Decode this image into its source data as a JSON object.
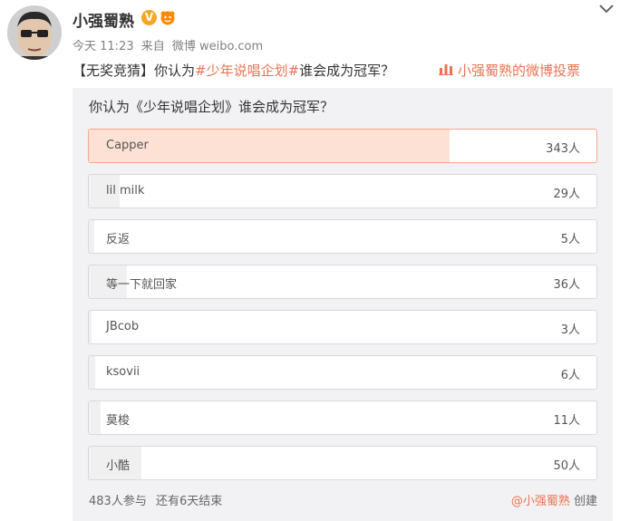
{
  "header": {
    "username": "小强蜀熟",
    "verified_symbol": "V",
    "meta": {
      "time": "今天 11:23",
      "source_prefix": "来自",
      "source": "微博 weibo.com"
    }
  },
  "post": {
    "prefix": "【无奖竞猜】你认为",
    "hashtag": "#少年说唱企划#",
    "suffix": "谁会成为冠军？",
    "vote_link": "小强蜀熟的微博投票"
  },
  "poll": {
    "question": "你认为《少年说唱企划》谁会成为冠军？",
    "options": [
      {
        "label": "Capper",
        "count_text": "343人",
        "votes": 343
      },
      {
        "label": "lil milk",
        "count_text": "29人",
        "votes": 29
      },
      {
        "label": "反返",
        "count_text": "5人",
        "votes": 5
      },
      {
        "label": "等一下就回家",
        "count_text": "36人",
        "votes": 36
      },
      {
        "label": "JBcob",
        "count_text": "3人",
        "votes": 3
      },
      {
        "label": "ksovii",
        "count_text": "6人",
        "votes": 6
      },
      {
        "label": "莫梭",
        "count_text": "11人",
        "votes": 11
      },
      {
        "label": "小酷",
        "count_text": "50人",
        "votes": 50
      }
    ],
    "footer": {
      "participants": "483人参与",
      "remaining": "还有6天结束",
      "creator": "@小强蜀熟",
      "created": "创建"
    }
  },
  "colors": {
    "accent": "#eb7350",
    "selected_fill": "#fde1d4",
    "fill": "#f0f0f0",
    "card_bg": "#f2f2f5"
  },
  "icons": [
    "avatar",
    "verified-icon",
    "level-badge-icon",
    "chevron-down-icon",
    "vote-icon"
  ]
}
